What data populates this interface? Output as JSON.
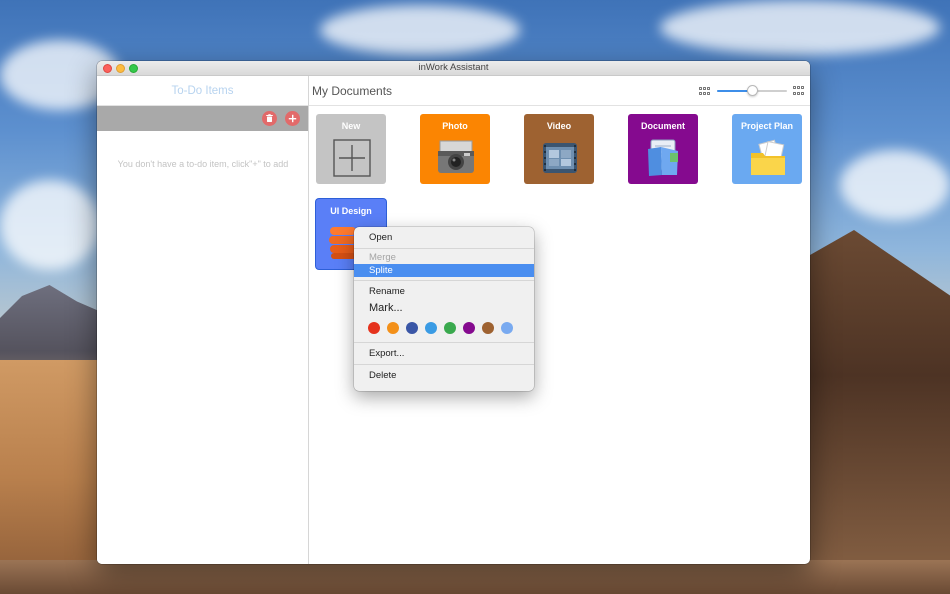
{
  "window": {
    "title": "inWork Assistant"
  },
  "sidebar": {
    "header": "To-Do Items",
    "empty_message": "You don't have a to-do item,  click\"+\" to add",
    "delete_icon": "trash-icon",
    "add_icon": "plus-icon"
  },
  "main": {
    "title": "My Documents",
    "zoom_slider_level": 0.5,
    "tiles": [
      {
        "label": "New",
        "color": "#c4c4c4",
        "icon": "new-document-icon"
      },
      {
        "label": "Photo",
        "color": "#fb8502",
        "icon": "camera-icon"
      },
      {
        "label": "Video",
        "color": "#9e6231",
        "icon": "film-icon"
      },
      {
        "label": "Document",
        "color": "#850a8f",
        "icon": "document-icon"
      },
      {
        "label": "Project Plan",
        "color": "#6aa9f1",
        "icon": "folder-icon"
      },
      {
        "label": "UI Design",
        "color": "#5a7ff7",
        "icon": "stack-icon"
      }
    ]
  },
  "context_menu": {
    "items": {
      "open": "Open",
      "merge": "Merge",
      "splite": "Splite",
      "rename": "Rename",
      "mark": "Mark...",
      "export": "Export...",
      "delete": "Delete"
    },
    "colors": [
      "#e5321d",
      "#f39019",
      "#3a56a6",
      "#3a9be4",
      "#3aa94e",
      "#850a8f",
      "#9e6231",
      "#79aaf0"
    ]
  }
}
